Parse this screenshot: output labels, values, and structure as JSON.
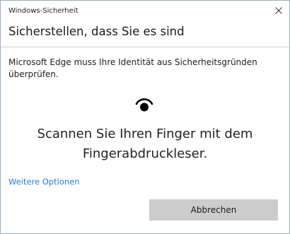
{
  "window": {
    "title": "Windows-Sicherheit",
    "close_glyph": "✕"
  },
  "dialog": {
    "heading": "Sicherstellen, dass Sie es sind",
    "message": "Microsoft Edge muss Ihre Identität aus Sicherheitsgründen überprüfen.",
    "icon": "fingerprint-icon",
    "instruction_line1": "Scannen Sie Ihren Finger mit dem",
    "instruction_line2": "Fingerabdruckleser.",
    "more_options_label": "Weitere Optionen",
    "cancel_label": "Abbrechen"
  },
  "colors": {
    "link": "#2e77d0",
    "button_bg": "#cccccc",
    "window_border": "#9aa9c4"
  }
}
